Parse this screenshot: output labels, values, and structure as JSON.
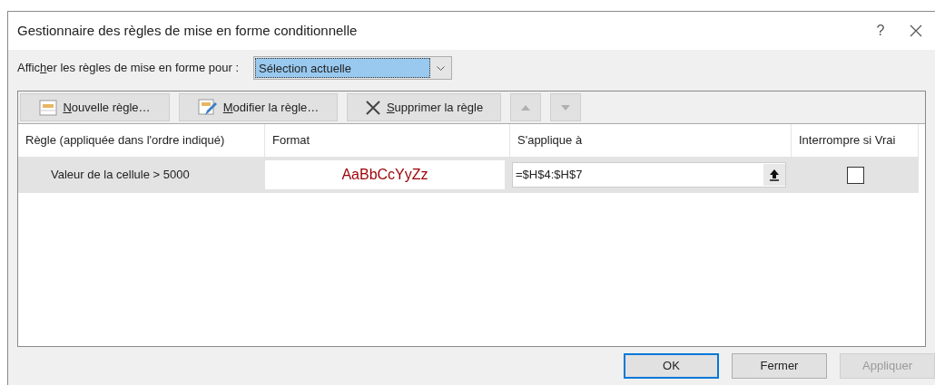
{
  "window": {
    "title": "Gestionnaire des règles de mise en forme conditionnelle",
    "help": "?"
  },
  "filter": {
    "label": [
      {
        "text": "Affic",
        "underlined": false
      },
      {
        "text": "h",
        "underlined": true
      },
      {
        "text": "er les règles de mise en forme pour :",
        "underlined": false
      }
    ],
    "value": "Sélection actuelle"
  },
  "toolbar": [
    {
      "kind": "new",
      "label": [
        {
          "text": "N",
          "underlined": true
        },
        {
          "text": "ouvelle règle…",
          "underlined": false
        }
      ],
      "disabled": false
    },
    {
      "kind": "edit",
      "label": [
        {
          "text": "M",
          "underlined": true
        },
        {
          "text": "odifier la règle…",
          "underlined": false
        }
      ],
      "disabled": false
    },
    {
      "kind": "delete",
      "label": [
        {
          "text": "S",
          "underlined": true
        },
        {
          "text": "upprimer la règle",
          "underlined": false
        }
      ],
      "disabled": false
    },
    {
      "kind": "up",
      "disabled": true
    },
    {
      "kind": "down",
      "disabled": true
    }
  ],
  "table": {
    "columns": [
      "Règle (appliquée dans l'ordre indiqué)",
      "Format",
      "S'applique à",
      "Interrompre si Vrai"
    ],
    "rows": [
      {
        "rule": "Valeur de la cellule > 5000",
        "format_preview": "AaBbCcYyZz",
        "applies_to": "=$H$4:$H$7",
        "stop_if_true": false,
        "selected": true
      }
    ]
  },
  "buttons": [
    {
      "label": "OK",
      "default": true,
      "disabled": false
    },
    {
      "label": "Fermer",
      "default": false,
      "disabled": false
    },
    {
      "label": "Appliquer",
      "default": false,
      "disabled": true
    }
  ]
}
